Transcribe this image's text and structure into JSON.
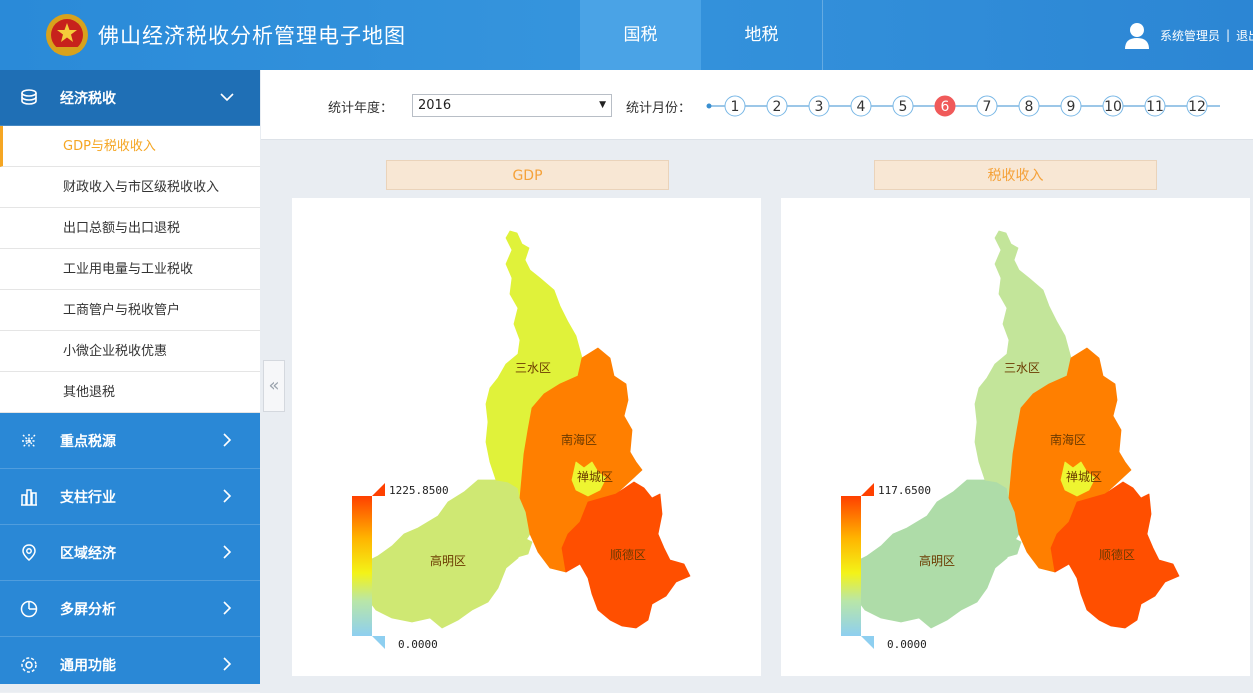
{
  "header": {
    "title": "佛山经济税收分析管理电子地图",
    "tabs": [
      "国税",
      "地税"
    ],
    "active_tab": "国税",
    "user": "系统管理员",
    "logout": "退出"
  },
  "sidebar": {
    "groups": [
      {
        "label": "经济税收",
        "icon": "coins-icon",
        "expanded": true,
        "items": [
          "GDP与税收收入",
          "财政收入与市区级税收收入",
          "出口总额与出口退税",
          "工业用电量与工业税收",
          "工商管户与税收管户",
          "小微企业税收优惠",
          "其他退税"
        ],
        "selected": "GDP与税收收入"
      },
      {
        "label": "重点税源",
        "icon": "scatter-icon"
      },
      {
        "label": "支柱行业",
        "icon": "buildings-icon"
      },
      {
        "label": "区域经济",
        "icon": "location-pin-icon"
      },
      {
        "label": "多屏分析",
        "icon": "pie-icon"
      },
      {
        "label": "通用功能",
        "icon": "gear-icon"
      }
    ]
  },
  "filter": {
    "year_label": "统计年度：",
    "year_value": "2016",
    "month_label": "统计月份：",
    "months": [
      "1",
      "2",
      "3",
      "4",
      "5",
      "6",
      "7",
      "8",
      "9",
      "10",
      "11",
      "12"
    ],
    "selected_month": "6"
  },
  "panels": [
    {
      "title": "GDP",
      "legend_max": "1225.8500",
      "legend_min": "0.0000",
      "districts": {
        "sanshui": "三水区",
        "nanhai": "南海区",
        "chancheng": "禅城区",
        "gaoming": "高明区",
        "shunde": "顺德区"
      },
      "colors": {
        "sanshui": "#e0f23a",
        "nanhai": "#ff7f00",
        "chancheng": "#eef530",
        "gaoming": "#cfe873",
        "shunde": "#ff4f00"
      }
    },
    {
      "title": "税收收入",
      "legend_max": "117.6500",
      "legend_min": "0.0000",
      "districts": {
        "sanshui": "三水区",
        "nanhai": "南海区",
        "chancheng": "禅城区",
        "gaoming": "高明区",
        "shunde": "顺德区"
      },
      "colors": {
        "sanshui": "#c3e59a",
        "nanhai": "#ff7f00",
        "chancheng": "#eef530",
        "gaoming": "#aedca8",
        "shunde": "#ff4f00"
      }
    }
  ]
}
